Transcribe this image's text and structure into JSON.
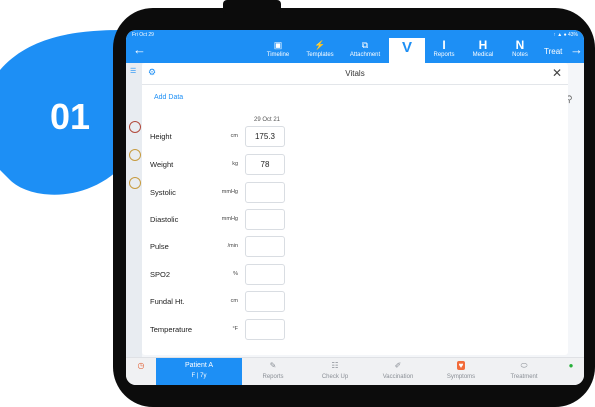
{
  "badge": {
    "number": "01",
    "color": "#1d8ff5"
  },
  "status_bar": {
    "time": "Fri Oct 29",
    "indicators": "↑ ▲ ● 43%"
  },
  "nav": {
    "back_icon": "arrow-left-icon",
    "items": [
      {
        "label": "Timeline",
        "icon": "image-icon",
        "glyph": "▣"
      },
      {
        "label": "Templates",
        "icon": "bolt-icon",
        "glyph": "⚡"
      },
      {
        "label": "Attachment",
        "icon": "copy-icon",
        "glyph": "⧉"
      },
      {
        "label": "",
        "icon": "letter-v-icon",
        "glyph": "V",
        "active": true
      },
      {
        "label": "Reports",
        "icon": "letter-i-icon",
        "glyph": "I"
      },
      {
        "label": "Medical",
        "icon": "letter-h-icon",
        "glyph": "H"
      },
      {
        "label": "Notes",
        "icon": "letter-n-icon",
        "glyph": "N"
      }
    ],
    "treat_label": "Treat",
    "forward_icon": "arrow-right-icon"
  },
  "modal": {
    "title": "Vitals",
    "add_data_label": "Add Data",
    "date_column": "29 Oct 21",
    "rows": [
      {
        "name": "Height",
        "unit": "cm",
        "value": "175.3"
      },
      {
        "name": "Weight",
        "unit": "kg",
        "value": "78"
      },
      {
        "name": "Systolic",
        "unit": "mmHg",
        "value": ""
      },
      {
        "name": "Diastolic",
        "unit": "mmHg",
        "value": ""
      },
      {
        "name": "Pulse",
        "unit": "/min",
        "value": ""
      },
      {
        "name": "SPO2",
        "unit": "%",
        "value": ""
      },
      {
        "name": "Fundal Ht.",
        "unit": "cm",
        "value": ""
      },
      {
        "name": "Temperature",
        "unit": "°F",
        "value": ""
      }
    ]
  },
  "bottom_bar": {
    "patient": {
      "name": "Patient  A",
      "info": "F | 7y"
    },
    "tabs": [
      {
        "label": "Reports",
        "icon": "pencil-icon",
        "glyph": "✎"
      },
      {
        "label": "Check Up",
        "icon": "clipboard-icon",
        "glyph": "☷"
      },
      {
        "label": "Vaccination",
        "icon": "syringe-icon",
        "glyph": "✐"
      },
      {
        "label": "Symptoms",
        "icon": "heart-icon",
        "glyph": "♥"
      },
      {
        "label": "Treatment",
        "icon": "pill-icon",
        "glyph": "⬭"
      }
    ]
  },
  "colors": {
    "primary": "#1d8ff5",
    "symptoms_accent": "#f26b3a",
    "device_frame": "#0c0c0c"
  }
}
